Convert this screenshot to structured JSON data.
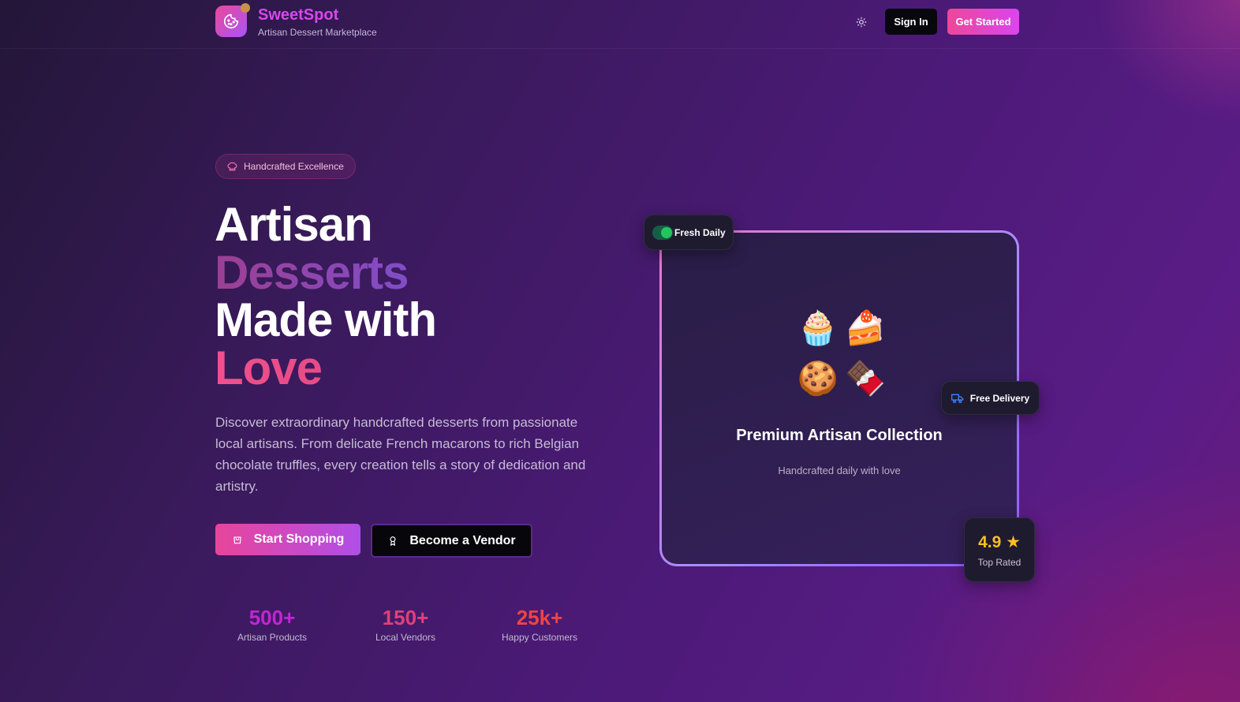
{
  "header": {
    "brand_name": "SweetSpot",
    "brand_tagline": "Artisan Dessert Marketplace",
    "logo_icon": "cookie-icon",
    "theme_icon": "sun-icon",
    "signin_label": "Sign In",
    "get_started_label": "Get Started"
  },
  "hero": {
    "badge": {
      "label": "Handcrafted Excellence",
      "icon": "chef-hat-icon"
    },
    "headline": [
      "Artisan",
      "Desserts",
      "Made with",
      "Love"
    ],
    "description": "Discover extraordinary handcrafted desserts from passionate local artisans. From delicate French macarons to rich Belgian chocolate truffles, every creation tells a story of dedication and artistry.",
    "primary_button": {
      "label": "Start Shopping",
      "icon": "shopping-bag-icon"
    },
    "secondary_button": {
      "label": "Become a Vendor",
      "icon": "award-icon"
    },
    "stats": [
      {
        "value": "500+",
        "label": "Artisan Products",
        "color": "#c026d3"
      },
      {
        "value": "150+",
        "label": "Local Vendors",
        "color": "#e0407a"
      },
      {
        "value": "25k+",
        "label": "Happy Customers",
        "color": "#ef4444"
      }
    ]
  },
  "showcase": {
    "emojis": [
      "🧁",
      "🍰",
      "🍪",
      "🍫"
    ],
    "title": "Premium Artisan Collection",
    "subtitle": "Handcrafted daily with love",
    "fresh_label": "Fresh Daily",
    "delivery_label": "Free Delivery",
    "delivery_icon": "truck-icon",
    "rating_value": "4.9",
    "rating_icon": "star-icon",
    "rating_label": "Top Rated"
  },
  "colors": {
    "accent_pink": "#ec4899",
    "accent_purple": "#a855f7",
    "rating_gold": "#fbbf24"
  }
}
